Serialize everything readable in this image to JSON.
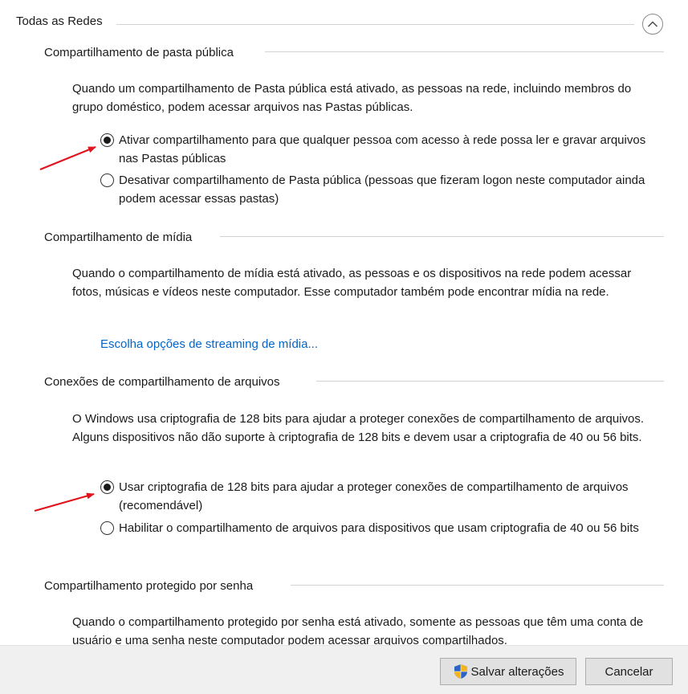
{
  "header": {
    "title": "Todas as Redes",
    "collapse_icon": "chevron-up-icon"
  },
  "sections": {
    "public_folder": {
      "title": "Compartilhamento de pasta pública",
      "description": "Quando um compartilhamento de Pasta pública está ativado, as pessoas na rede, incluindo membros do grupo doméstico, podem acessar arquivos nas Pastas públicas.",
      "options": [
        {
          "label": "Ativar compartilhamento para que qualquer pessoa com acesso à rede possa ler e gravar arquivos nas Pastas públicas",
          "checked": true
        },
        {
          "label": "Desativar compartilhamento de Pasta pública (pessoas que fizeram logon neste computador ainda podem acessar essas pastas)",
          "checked": false
        }
      ]
    },
    "media": {
      "title": "Compartilhamento de mídia",
      "description": "Quando o compartilhamento de mídia está ativado, as pessoas e os dispositivos na rede podem acessar fotos, músicas e vídeos neste computador. Esse computador também pode encontrar mídia na rede.",
      "link": "Escolha opções de streaming de mídia..."
    },
    "file_sharing": {
      "title": "Conexões de compartilhamento de arquivos",
      "description": "O Windows usa criptografia de 128 bits para ajudar a proteger conexões de compartilhamento de arquivos. Alguns dispositivos não dão suporte à criptografia de 128 bits e devem usar a criptografia de 40 ou 56 bits.",
      "options": [
        {
          "label": "Usar criptografia de 128 bits para ajudar a proteger conexões de compartilhamento de arquivos (recomendável)",
          "checked": true
        },
        {
          "label": "Habilitar o compartilhamento de arquivos para dispositivos que usam criptografia de 40 ou 56 bits",
          "checked": false
        }
      ]
    },
    "password": {
      "title": "Compartilhamento protegido por senha",
      "description": "Quando o compartilhamento protegido por senha está ativado, somente as pessoas que têm uma conta de usuário e uma senha neste computador podem acessar arquivos compartilhados."
    }
  },
  "buttons": {
    "save_label": "Salvar alterações",
    "save_icon": "uac-shield-icon",
    "cancel_label": "Cancelar"
  },
  "colors": {
    "link": "#0066cc",
    "annotation_arrow": "#e0141e",
    "button_bar": "#f0f0f0"
  }
}
